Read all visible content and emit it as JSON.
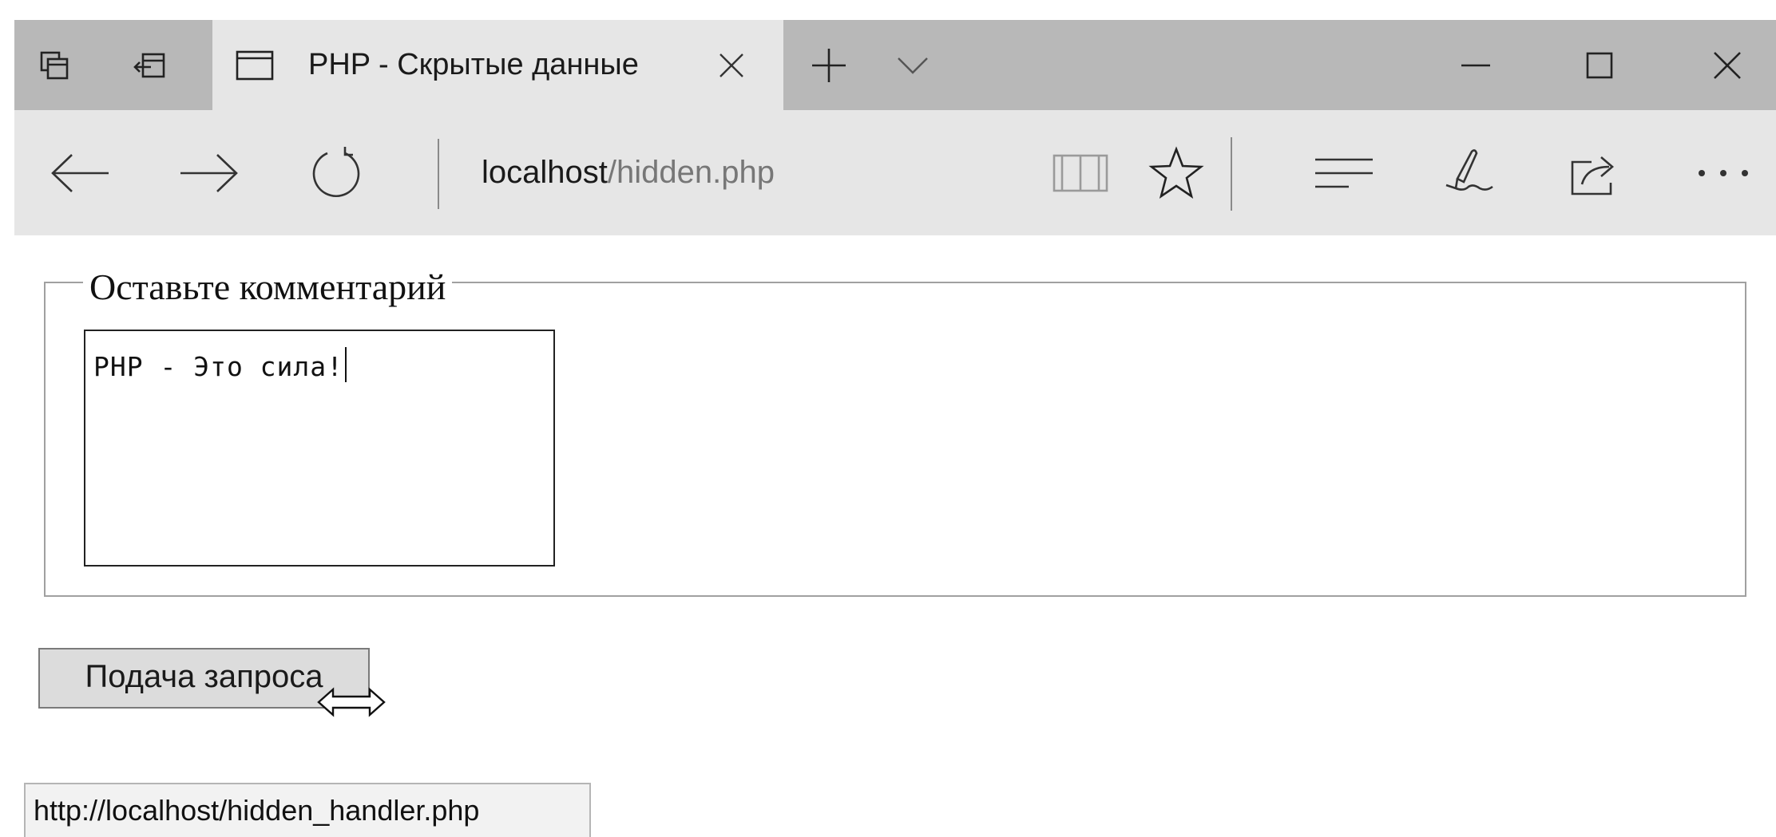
{
  "tab": {
    "title": "PHP - Скрытые данные"
  },
  "address_bar": {
    "host": "localhost",
    "path": "/hidden.php"
  },
  "toolbar_icons": [
    "tab-preview-icon",
    "set-aside-tabs-icon",
    "reading-view-icon",
    "favorite-star-icon",
    "hub-icon",
    "web-note-icon",
    "share-icon",
    "more-icon"
  ],
  "form": {
    "legend": "Оставьте комментарий",
    "comment_value": "PHP - Это сила!",
    "submit_label": "Подача запроса"
  },
  "status_bar": {
    "url": "http://localhost/hidden_handler.php"
  }
}
